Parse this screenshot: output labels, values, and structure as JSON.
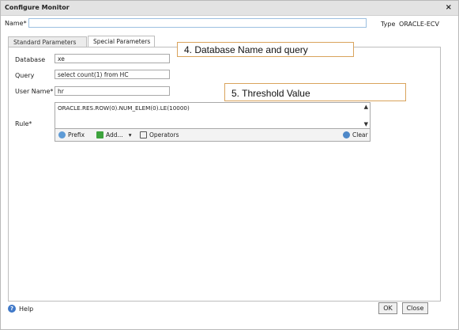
{
  "window": {
    "title": "Configure Monitor",
    "close_label": "×"
  },
  "header": {
    "name_label": "Name*",
    "name_value": "",
    "type_label": "Type",
    "type_value": "ORACLE-ECV"
  },
  "tabs": [
    {
      "label": "Standard Parameters"
    },
    {
      "label": "Special Parameters"
    }
  ],
  "form": {
    "database_label": "Database",
    "database_value": "xe",
    "query_label": "Query",
    "query_value": "select count(1) from HC",
    "username_label": "User Name*",
    "username_value": "hr",
    "rule_label": "Rule*",
    "rule_value": "ORACLE.RES.ROW(0).NUM_ELEM(0).LE(10000)"
  },
  "rule_toolbar": {
    "prefix_label": "Prefix",
    "add_label": "Add...",
    "add_arrow": "▾",
    "operators_label": "Operators",
    "clear_label": "Clear"
  },
  "callouts": {
    "database_query": "4. Database Name and query",
    "threshold": "5. Threshold Value"
  },
  "footer": {
    "help_label": "Help",
    "ok_label": "OK",
    "close_label": "Close"
  },
  "colors": {
    "callout_border": "#d9a35c",
    "help_icon": "#3f78c8",
    "add_icon": "#3da33d"
  }
}
